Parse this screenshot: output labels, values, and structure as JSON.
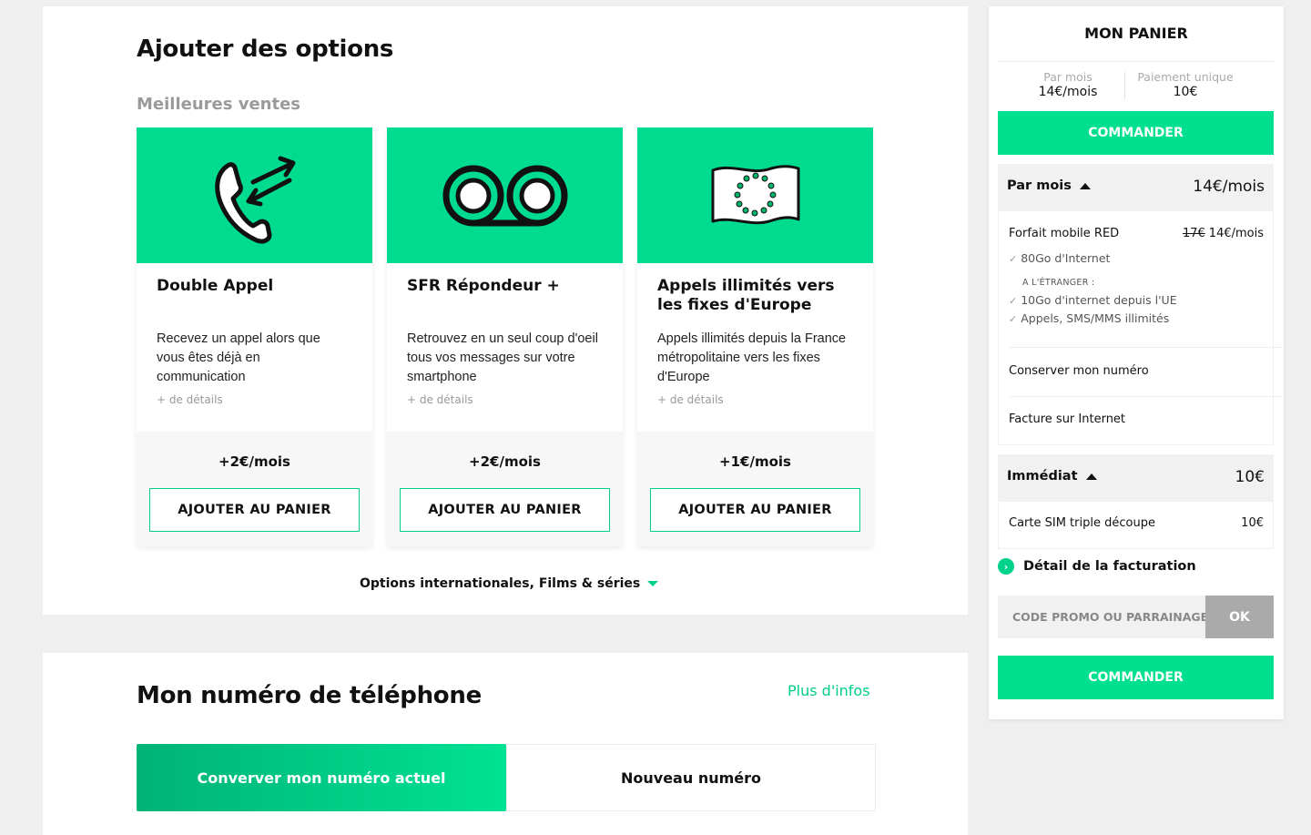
{
  "options": {
    "title": "Ajouter des options",
    "subtitle": "Meilleures ventes",
    "cards": [
      {
        "title": "Double Appel",
        "desc": "Recevez un appel alors que vous êtes déjà en communication",
        "more": "+ de détails",
        "price": "+2€/mois",
        "button": "AJOUTER AU PANIER",
        "icon": "phone-arrows-icon"
      },
      {
        "title": "SFR Répondeur +",
        "desc": "Retrouvez en un seul coup d'oeil tous vos messages sur votre smartphone",
        "more": "+ de détails",
        "price": "+2€/mois",
        "button": "AJOUTER AU PANIER",
        "icon": "voicemail-icon"
      },
      {
        "title": "Appels illimités vers les fixes d'Europe",
        "desc": "Appels illimités depuis la France métropolitaine vers les fixes d'Europe",
        "more": "+ de détails",
        "price": "+1€/mois",
        "button": "AJOUTER AU PANIER",
        "icon": "eu-flag-icon"
      }
    ],
    "more_link": "Options internationales, Films & séries"
  },
  "phone": {
    "title": "Mon numéro de téléphone",
    "info_link": "Plus d'infos",
    "keep_label": "Converver mon numéro actuel",
    "new_label": "Nouveau numéro"
  },
  "cart": {
    "title": "MON PANIER",
    "monthly_label": "Par mois",
    "monthly_value": "14€/mois",
    "once_label": "Paiement unique",
    "once_value": "10€",
    "order_label": "COMMANDER",
    "monthly_section": {
      "label": "Par mois",
      "amount": "14€/mois",
      "plan_name": "Forfait mobile RED",
      "plan_old": "17€",
      "plan_price": "14€/mois",
      "feat_data": "80Go d'Internet",
      "abroad_caption": "A L'ÉTRANGER :",
      "feat_eu_data": "10Go d'internet depuis l'UE",
      "feat_eu_calls": "Appels, SMS/MMS illimités",
      "keep_number": "Conserver mon numéro",
      "bill": "Facture sur Internet"
    },
    "immediate_section": {
      "label": "Immédiat",
      "amount": "10€",
      "sim_label": "Carte SIM triple découpe",
      "sim_price": "10€"
    },
    "detail_label": "Détail de la facturation",
    "promo_placeholder": "CODE PROMO OU PARRAINAGE",
    "ok_label": "OK"
  },
  "colors": {
    "accent": "#00dc8f",
    "text": "#111111",
    "muted": "#999999"
  }
}
